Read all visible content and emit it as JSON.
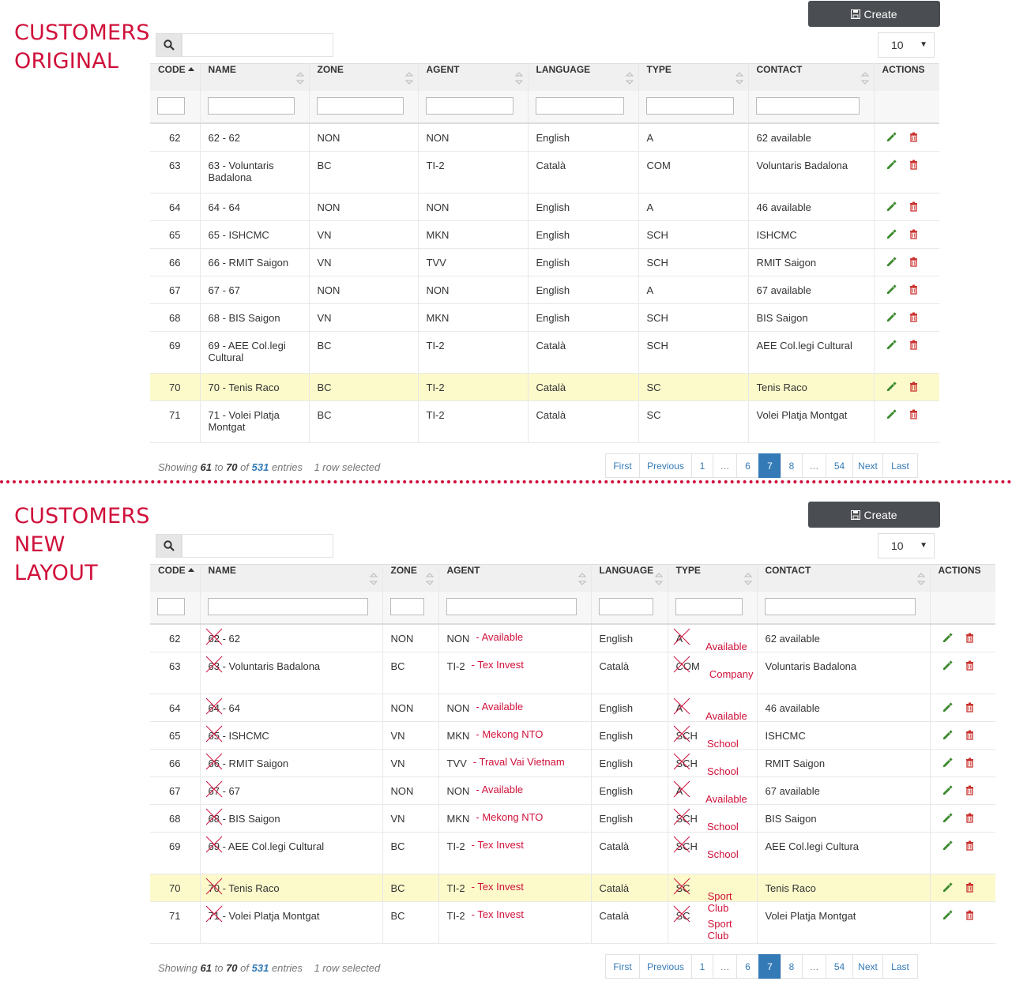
{
  "colors": {
    "accent": "#d0103a",
    "selected_row": "#fcfacb",
    "pager_active": "#337ab7",
    "create_button": "#4a4d52"
  },
  "original": {
    "title_line1": "CUSTOMERS",
    "title_line2": "ORIGINAL",
    "create_label": "Create",
    "page_length": "10",
    "headers": [
      "CODE",
      "NAME",
      "ZONE",
      "AGENT",
      "LANGUAGE",
      "TYPE",
      "CONTACT",
      "ACTIONS"
    ],
    "rows": [
      {
        "code": "62",
        "name": "62 - 62",
        "zone": "NON",
        "agent": "NON",
        "language": "English",
        "type": "A",
        "contact": "62 available"
      },
      {
        "code": "63",
        "name": "63 - Voluntaris Badalona",
        "zone": "BC",
        "agent": "TI-2",
        "language": "Català",
        "type": "COM",
        "contact": "Voluntaris Badalona"
      },
      {
        "code": "64",
        "name": "64 - 64",
        "zone": "NON",
        "agent": "NON",
        "language": "English",
        "type": "A",
        "contact": "46 available"
      },
      {
        "code": "65",
        "name": "65 - ISHCMC",
        "zone": "VN",
        "agent": "MKN",
        "language": "English",
        "type": "SCH",
        "contact": "ISHCMC"
      },
      {
        "code": "66",
        "name": "66 - RMIT Saigon",
        "zone": "VN",
        "agent": "TVV",
        "language": "English",
        "type": "SCH",
        "contact": "RMIT Saigon"
      },
      {
        "code": "67",
        "name": "67 - 67",
        "zone": "NON",
        "agent": "NON",
        "language": "English",
        "type": "A",
        "contact": "67 available"
      },
      {
        "code": "68",
        "name": "68 - BIS Saigon",
        "zone": "VN",
        "agent": "MKN",
        "language": "English",
        "type": "SCH",
        "contact": "BIS Saigon"
      },
      {
        "code": "69",
        "name": "69 - AEE Col.legi Cultural",
        "zone": "BC",
        "agent": "TI-2",
        "language": "Català",
        "type": "SCH",
        "contact": "AEE Col.legi Cultural"
      },
      {
        "code": "70",
        "name": "70 - Tenis Raco",
        "zone": "BC",
        "agent": "TI-2",
        "language": "Català",
        "type": "SC",
        "contact": "Tenis Raco"
      },
      {
        "code": "71",
        "name": "71 - Volei Platja Montgat",
        "zone": "BC",
        "agent": "TI-2",
        "language": "Català",
        "type": "SC",
        "contact": "Volei Platja Montgat"
      }
    ]
  },
  "new_layout": {
    "title_line1": "CUSTOMERS",
    "title_line2": "NEW",
    "title_line3": "LAYOUT",
    "create_label": "Create",
    "page_length": "10",
    "headers": [
      "CODE",
      "NAME",
      "ZONE",
      "AGENT",
      "LANGUAGE",
      "TYPE",
      "CONTACT",
      "ACTIONS"
    ],
    "rows": [
      {
        "code": "62",
        "name_code": "62",
        "name_rest": " - 62",
        "zone": "NON",
        "agent": "NON",
        "agent_desc": "- Available",
        "language": "English",
        "type": "A",
        "type_desc": "Available",
        "contact": "62 available"
      },
      {
        "code": "63",
        "name_code": "63",
        "name_rest": " - Voluntaris Badalona",
        "zone": "BC",
        "agent": "TI-2",
        "agent_desc": "- Tex Invest",
        "language": "Català",
        "type": "COM",
        "type_desc": "Company",
        "contact": "Voluntaris Badalona"
      },
      {
        "code": "64",
        "name_code": "64",
        "name_rest": " - 64",
        "zone": "NON",
        "agent": "NON",
        "agent_desc": "- Available",
        "language": "English",
        "type": "A",
        "type_desc": "Available",
        "contact": "46 available"
      },
      {
        "code": "65",
        "name_code": "65",
        "name_rest": " - ISHCMC",
        "zone": "VN",
        "agent": "MKN",
        "agent_desc": "- Mekong NTO",
        "language": "English",
        "type": "SCH",
        "type_desc": "School",
        "contact": "ISHCMC"
      },
      {
        "code": "66",
        "name_code": "66",
        "name_rest": " - RMIT Saigon",
        "zone": "VN",
        "agent": "TVV",
        "agent_desc": "- Traval Vai Vietnam",
        "language": "English",
        "type": "SCH",
        "type_desc": "School",
        "contact": "RMIT Saigon"
      },
      {
        "code": "67",
        "name_code": "67",
        "name_rest": " - 67",
        "zone": "NON",
        "agent": "NON",
        "agent_desc": "- Available",
        "language": "English",
        "type": "A",
        "type_desc": "Available",
        "contact": "67 available"
      },
      {
        "code": "68",
        "name_code": "68",
        "name_rest": " - BIS Saigon",
        "zone": "VN",
        "agent": "MKN",
        "agent_desc": "- Mekong NTO",
        "language": "English",
        "type": "SCH",
        "type_desc": "School",
        "contact": "BIS Saigon"
      },
      {
        "code": "69",
        "name_code": "69",
        "name_rest": " - AEE Col.legi Cultural",
        "zone": "BC",
        "agent": "TI-2",
        "agent_desc": "- Tex Invest",
        "language": "Català",
        "type": "SCH",
        "type_desc": "School",
        "contact": "AEE Col.legi Cultura"
      },
      {
        "code": "70",
        "name_code": "70",
        "name_rest": " - Tenis Raco",
        "zone": "BC",
        "agent": "TI-2",
        "agent_desc": "- Tex Invest",
        "language": "Català",
        "type": "SC",
        "type_desc": "Sport Club",
        "contact": "Tenis Raco"
      },
      {
        "code": "71",
        "name_code": "71",
        "name_rest": " - Volei Platja Montgat",
        "zone": "BC",
        "agent": "TI-2",
        "agent_desc": "- Tex Invest",
        "language": "Català",
        "type": "SC",
        "type_desc": "Sport Club",
        "contact": "Volei Platja Montgat"
      }
    ]
  },
  "info": {
    "showing": "Showing",
    "from": "61",
    "to_word": "to",
    "to": "70",
    "of_word": "of",
    "total": "531",
    "entries": "entries",
    "selected": "1 row selected"
  },
  "pager": [
    "First",
    "Previous",
    "1",
    "…",
    "6",
    "7",
    "8",
    "…",
    "54",
    "Next",
    "Last"
  ],
  "pager_active": "7",
  "selected_code": "70",
  "icons": [
    "search-icon",
    "save-icon",
    "sort-asc-icon",
    "sort-both-icon",
    "pencil-icon",
    "trash-icon",
    "cross-out-mark"
  ]
}
